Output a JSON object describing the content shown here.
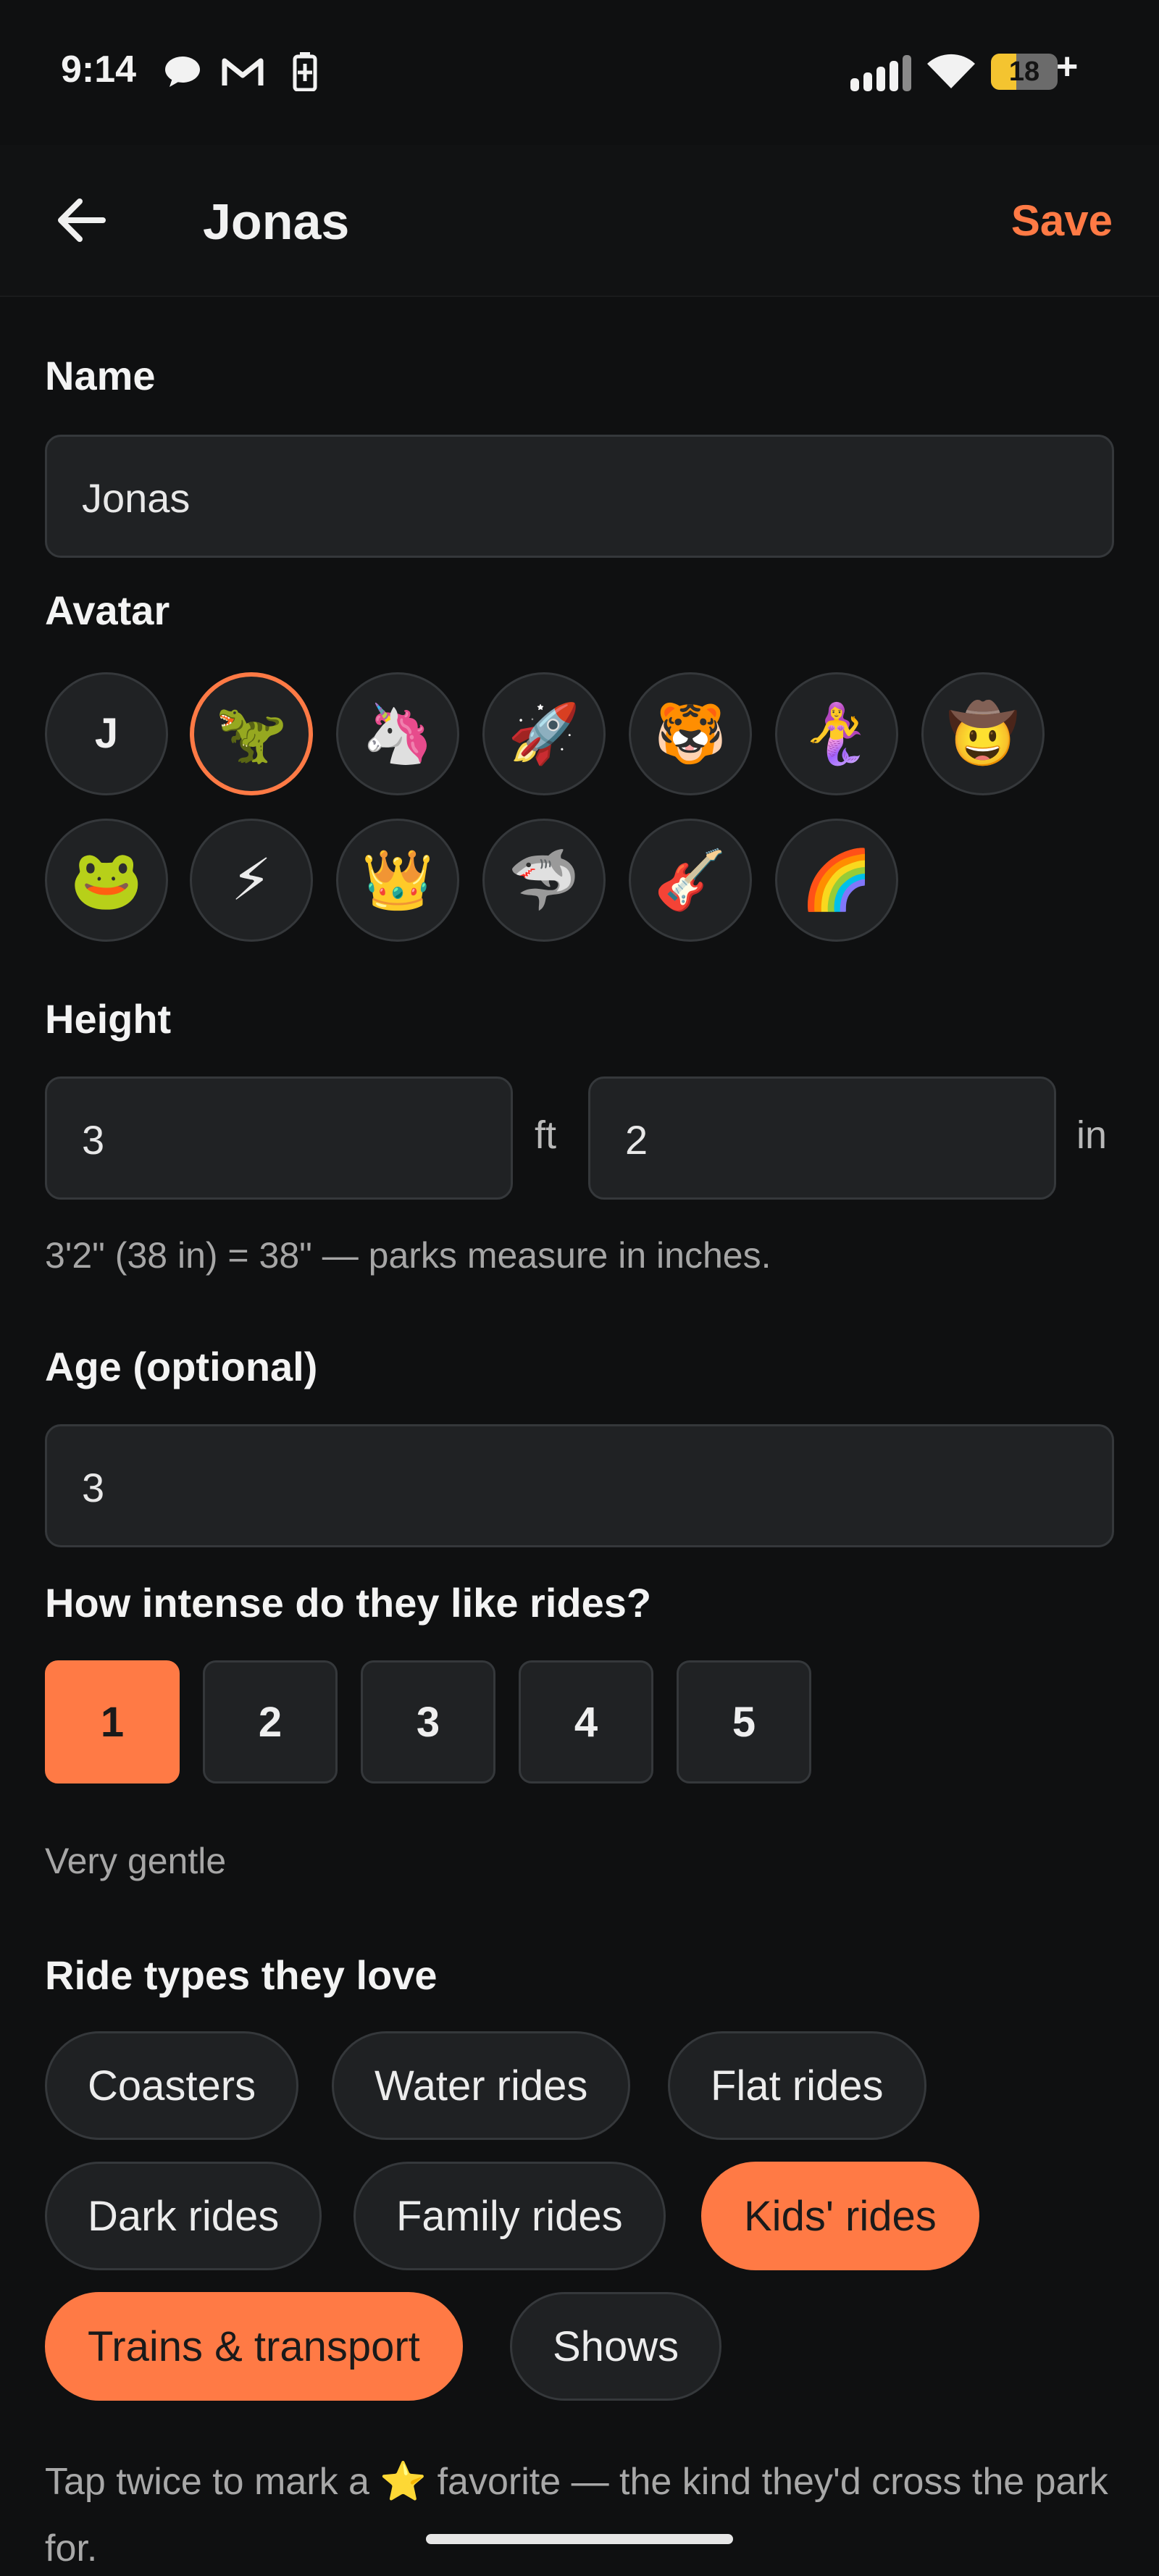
{
  "status_bar": {
    "time": "9:14",
    "icons": [
      "chat-bubble-icon",
      "gmail-icon",
      "battery-saver-icon",
      "signal-icon",
      "wifi-icon"
    ],
    "battery_level": "18",
    "battery_fraction": 0.18,
    "charging_glyph": "+"
  },
  "app_bar": {
    "title": "Jonas",
    "save_label": "Save",
    "accent_color": "#ff7a45"
  },
  "form": {
    "name_label": "Name",
    "name_value": "Jonas",
    "avatar_label": "Avatar",
    "avatars": [
      {
        "id": "letter",
        "glyph": "J",
        "selected": false
      },
      {
        "id": "dinosaur",
        "glyph": "🦖",
        "selected": true
      },
      {
        "id": "unicorn",
        "glyph": "🦄",
        "selected": false
      },
      {
        "id": "rocket",
        "glyph": "🚀",
        "selected": false
      },
      {
        "id": "tiger",
        "glyph": "🐯",
        "selected": false
      },
      {
        "id": "mermaid",
        "glyph": "🧜‍♀️",
        "selected": false
      },
      {
        "id": "cowboy",
        "glyph": "🤠",
        "selected": false
      },
      {
        "id": "frog",
        "glyph": "🐸",
        "selected": false
      },
      {
        "id": "lightning",
        "glyph": "⚡",
        "selected": false
      },
      {
        "id": "crown",
        "glyph": "👑",
        "selected": false
      },
      {
        "id": "shark",
        "glyph": "🦈",
        "selected": false
      },
      {
        "id": "guitar",
        "glyph": "🎸",
        "selected": false
      },
      {
        "id": "rainbow",
        "glyph": "🌈",
        "selected": false
      }
    ],
    "height_label": "Height",
    "height_ft_value": "3",
    "height_ft_unit": "ft",
    "height_in_value": "2",
    "height_in_unit": "in",
    "height_hint": "3'2\" (38 in) = 38\" — parks measure in inches.",
    "age_label": "Age (optional)",
    "age_value": "3",
    "intensity_label": "How intense do they like rides?",
    "intensity_options": [
      "1",
      "2",
      "3",
      "4",
      "5"
    ],
    "intensity_selected": "1",
    "intensity_description": "Very gentle",
    "ride_types_label": "Ride types they love",
    "ride_types": [
      {
        "label": "Coasters",
        "selected": false
      },
      {
        "label": "Water rides",
        "selected": false
      },
      {
        "label": "Flat rides",
        "selected": false
      },
      {
        "label": "Dark rides",
        "selected": false
      },
      {
        "label": "Family rides",
        "selected": false
      },
      {
        "label": "Kids' rides",
        "selected": true
      },
      {
        "label": "Trains & transport",
        "selected": true
      },
      {
        "label": "Shows",
        "selected": false
      }
    ],
    "favorite_hint_before": "Tap twice to mark a",
    "favorite_star": "⭐",
    "favorite_hint_after": "favorite — the kind they'd cross the park for."
  }
}
